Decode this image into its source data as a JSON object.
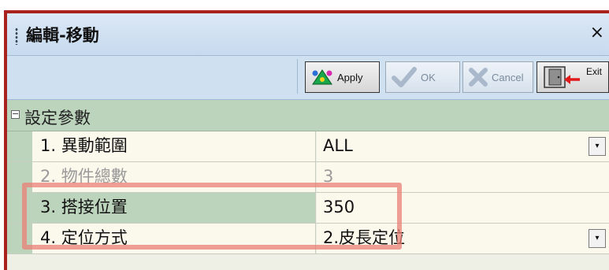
{
  "window": {
    "title": "編輯-移動",
    "close_glyph": "×"
  },
  "toolbar": {
    "apply_label": "Apply",
    "ok_label": "OK",
    "cancel_label": "Cancel",
    "exit_label": "Exit"
  },
  "category": {
    "toggle": "−",
    "label": "設定參數"
  },
  "properties": [
    {
      "name": "1. 異動範圍",
      "value": "ALL",
      "dropdown": true,
      "enabled": true
    },
    {
      "name": "2. 物件總數",
      "value": "3",
      "dropdown": false,
      "enabled": false
    },
    {
      "name": "3. 搭接位置",
      "value": "350",
      "dropdown": false,
      "enabled": true,
      "selected": true
    },
    {
      "name": "4. 定位方式",
      "value": "2.皮長定位",
      "dropdown": true,
      "enabled": true
    }
  ],
  "icons": {
    "dropdown": "▾",
    "apply": "apply-icon",
    "ok": "checkmark-icon",
    "cancel": "x-icon",
    "exit": "exit-door-icon"
  },
  "colors": {
    "frame_border": "#a8231e",
    "highlight": "#e98076",
    "category_bg": "#bcd3bc",
    "row_bg": "#fbf8ec",
    "toolbar_bg": "#cfe0f1"
  }
}
